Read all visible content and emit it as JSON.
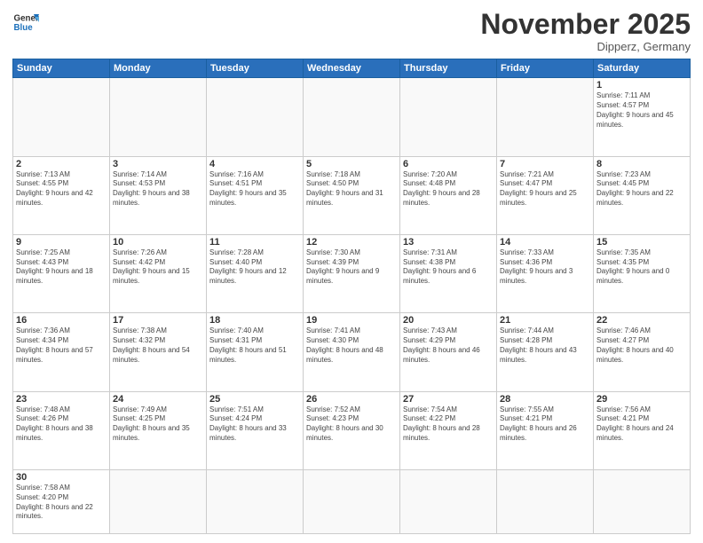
{
  "header": {
    "logo_general": "General",
    "logo_blue": "Blue",
    "month_title": "November 2025",
    "location": "Dipperz, Germany"
  },
  "weekdays": [
    "Sunday",
    "Monday",
    "Tuesday",
    "Wednesday",
    "Thursday",
    "Friday",
    "Saturday"
  ],
  "days": {
    "d1": {
      "num": "1",
      "sunrise": "7:11 AM",
      "sunset": "4:57 PM",
      "daylight": "9 hours and 45 minutes."
    },
    "d2": {
      "num": "2",
      "sunrise": "7:13 AM",
      "sunset": "4:55 PM",
      "daylight": "9 hours and 42 minutes."
    },
    "d3": {
      "num": "3",
      "sunrise": "7:14 AM",
      "sunset": "4:53 PM",
      "daylight": "9 hours and 38 minutes."
    },
    "d4": {
      "num": "4",
      "sunrise": "7:16 AM",
      "sunset": "4:51 PM",
      "daylight": "9 hours and 35 minutes."
    },
    "d5": {
      "num": "5",
      "sunrise": "7:18 AM",
      "sunset": "4:50 PM",
      "daylight": "9 hours and 31 minutes."
    },
    "d6": {
      "num": "6",
      "sunrise": "7:20 AM",
      "sunset": "4:48 PM",
      "daylight": "9 hours and 28 minutes."
    },
    "d7": {
      "num": "7",
      "sunrise": "7:21 AM",
      "sunset": "4:47 PM",
      "daylight": "9 hours and 25 minutes."
    },
    "d8": {
      "num": "8",
      "sunrise": "7:23 AM",
      "sunset": "4:45 PM",
      "daylight": "9 hours and 22 minutes."
    },
    "d9": {
      "num": "9",
      "sunrise": "7:25 AM",
      "sunset": "4:43 PM",
      "daylight": "9 hours and 18 minutes."
    },
    "d10": {
      "num": "10",
      "sunrise": "7:26 AM",
      "sunset": "4:42 PM",
      "daylight": "9 hours and 15 minutes."
    },
    "d11": {
      "num": "11",
      "sunrise": "7:28 AM",
      "sunset": "4:40 PM",
      "daylight": "9 hours and 12 minutes."
    },
    "d12": {
      "num": "12",
      "sunrise": "7:30 AM",
      "sunset": "4:39 PM",
      "daylight": "9 hours and 9 minutes."
    },
    "d13": {
      "num": "13",
      "sunrise": "7:31 AM",
      "sunset": "4:38 PM",
      "daylight": "9 hours and 6 minutes."
    },
    "d14": {
      "num": "14",
      "sunrise": "7:33 AM",
      "sunset": "4:36 PM",
      "daylight": "9 hours and 3 minutes."
    },
    "d15": {
      "num": "15",
      "sunrise": "7:35 AM",
      "sunset": "4:35 PM",
      "daylight": "9 hours and 0 minutes."
    },
    "d16": {
      "num": "16",
      "sunrise": "7:36 AM",
      "sunset": "4:34 PM",
      "daylight": "8 hours and 57 minutes."
    },
    "d17": {
      "num": "17",
      "sunrise": "7:38 AM",
      "sunset": "4:32 PM",
      "daylight": "8 hours and 54 minutes."
    },
    "d18": {
      "num": "18",
      "sunrise": "7:40 AM",
      "sunset": "4:31 PM",
      "daylight": "8 hours and 51 minutes."
    },
    "d19": {
      "num": "19",
      "sunrise": "7:41 AM",
      "sunset": "4:30 PM",
      "daylight": "8 hours and 48 minutes."
    },
    "d20": {
      "num": "20",
      "sunrise": "7:43 AM",
      "sunset": "4:29 PM",
      "daylight": "8 hours and 46 minutes."
    },
    "d21": {
      "num": "21",
      "sunrise": "7:44 AM",
      "sunset": "4:28 PM",
      "daylight": "8 hours and 43 minutes."
    },
    "d22": {
      "num": "22",
      "sunrise": "7:46 AM",
      "sunset": "4:27 PM",
      "daylight": "8 hours and 40 minutes."
    },
    "d23": {
      "num": "23",
      "sunrise": "7:48 AM",
      "sunset": "4:26 PM",
      "daylight": "8 hours and 38 minutes."
    },
    "d24": {
      "num": "24",
      "sunrise": "7:49 AM",
      "sunset": "4:25 PM",
      "daylight": "8 hours and 35 minutes."
    },
    "d25": {
      "num": "25",
      "sunrise": "7:51 AM",
      "sunset": "4:24 PM",
      "daylight": "8 hours and 33 minutes."
    },
    "d26": {
      "num": "26",
      "sunrise": "7:52 AM",
      "sunset": "4:23 PM",
      "daylight": "8 hours and 30 minutes."
    },
    "d27": {
      "num": "27",
      "sunrise": "7:54 AM",
      "sunset": "4:22 PM",
      "daylight": "8 hours and 28 minutes."
    },
    "d28": {
      "num": "28",
      "sunrise": "7:55 AM",
      "sunset": "4:21 PM",
      "daylight": "8 hours and 26 minutes."
    },
    "d29": {
      "num": "29",
      "sunrise": "7:56 AM",
      "sunset": "4:21 PM",
      "daylight": "8 hours and 24 minutes."
    },
    "d30": {
      "num": "30",
      "sunrise": "7:58 AM",
      "sunset": "4:20 PM",
      "daylight": "8 hours and 22 minutes."
    }
  }
}
